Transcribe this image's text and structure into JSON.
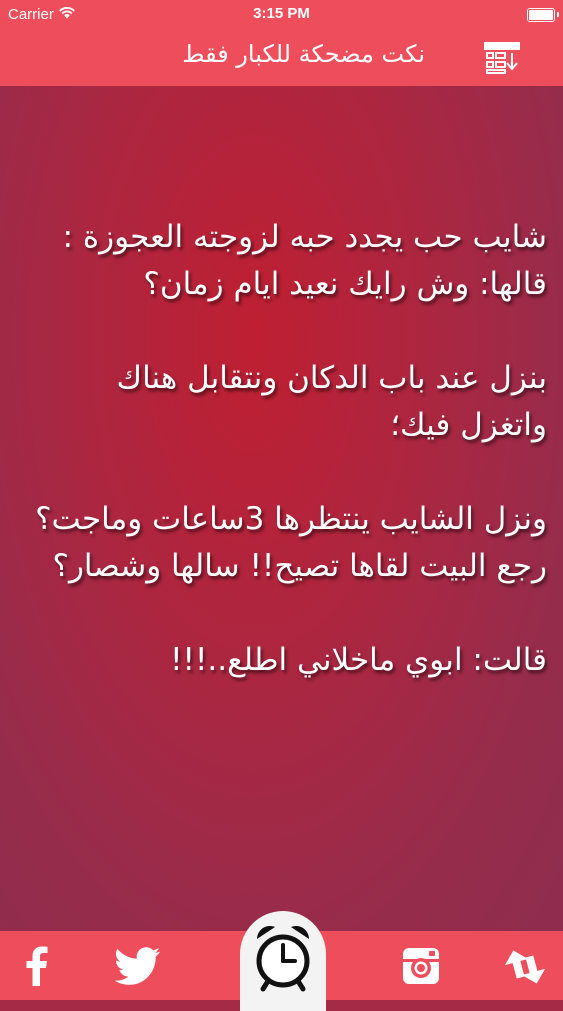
{
  "status_bar": {
    "carrier": "Carrier",
    "time": "3:15 PM",
    "icons": [
      "wifi-icon",
      "battery-icon"
    ]
  },
  "nav": {
    "title": "نكت مضحكة للكبار فقط",
    "menu_icon": "list-download-icon"
  },
  "joke": {
    "paragraphs": [
      "شايب حب يجدد حبه لزوجته العجوزة : قالها: وش رايك نعيد ايام زمان؟",
      "بنزل عند باب الدكان ونتقابل هناك واتغزل فيك؛",
      "ونزل الشايب ينتظرها 3ساعات وماجت؟رجع البيت لقاها تصيح!! سالها وشصار؟",
      "قالت: ابوي ماخلاني اطلع..!!!"
    ]
  },
  "tab_bar": {
    "items": [
      {
        "name": "facebook-icon"
      },
      {
        "name": "twitter-icon"
      },
      {
        "name": "alarm-clock-icon"
      },
      {
        "name": "instagram-icon"
      },
      {
        "name": "share-icon"
      }
    ]
  },
  "colors": {
    "accent": "#ee4e5b",
    "background": "#a52a45",
    "text": "#ffffff",
    "clock_tab": "#f3f3f3"
  }
}
